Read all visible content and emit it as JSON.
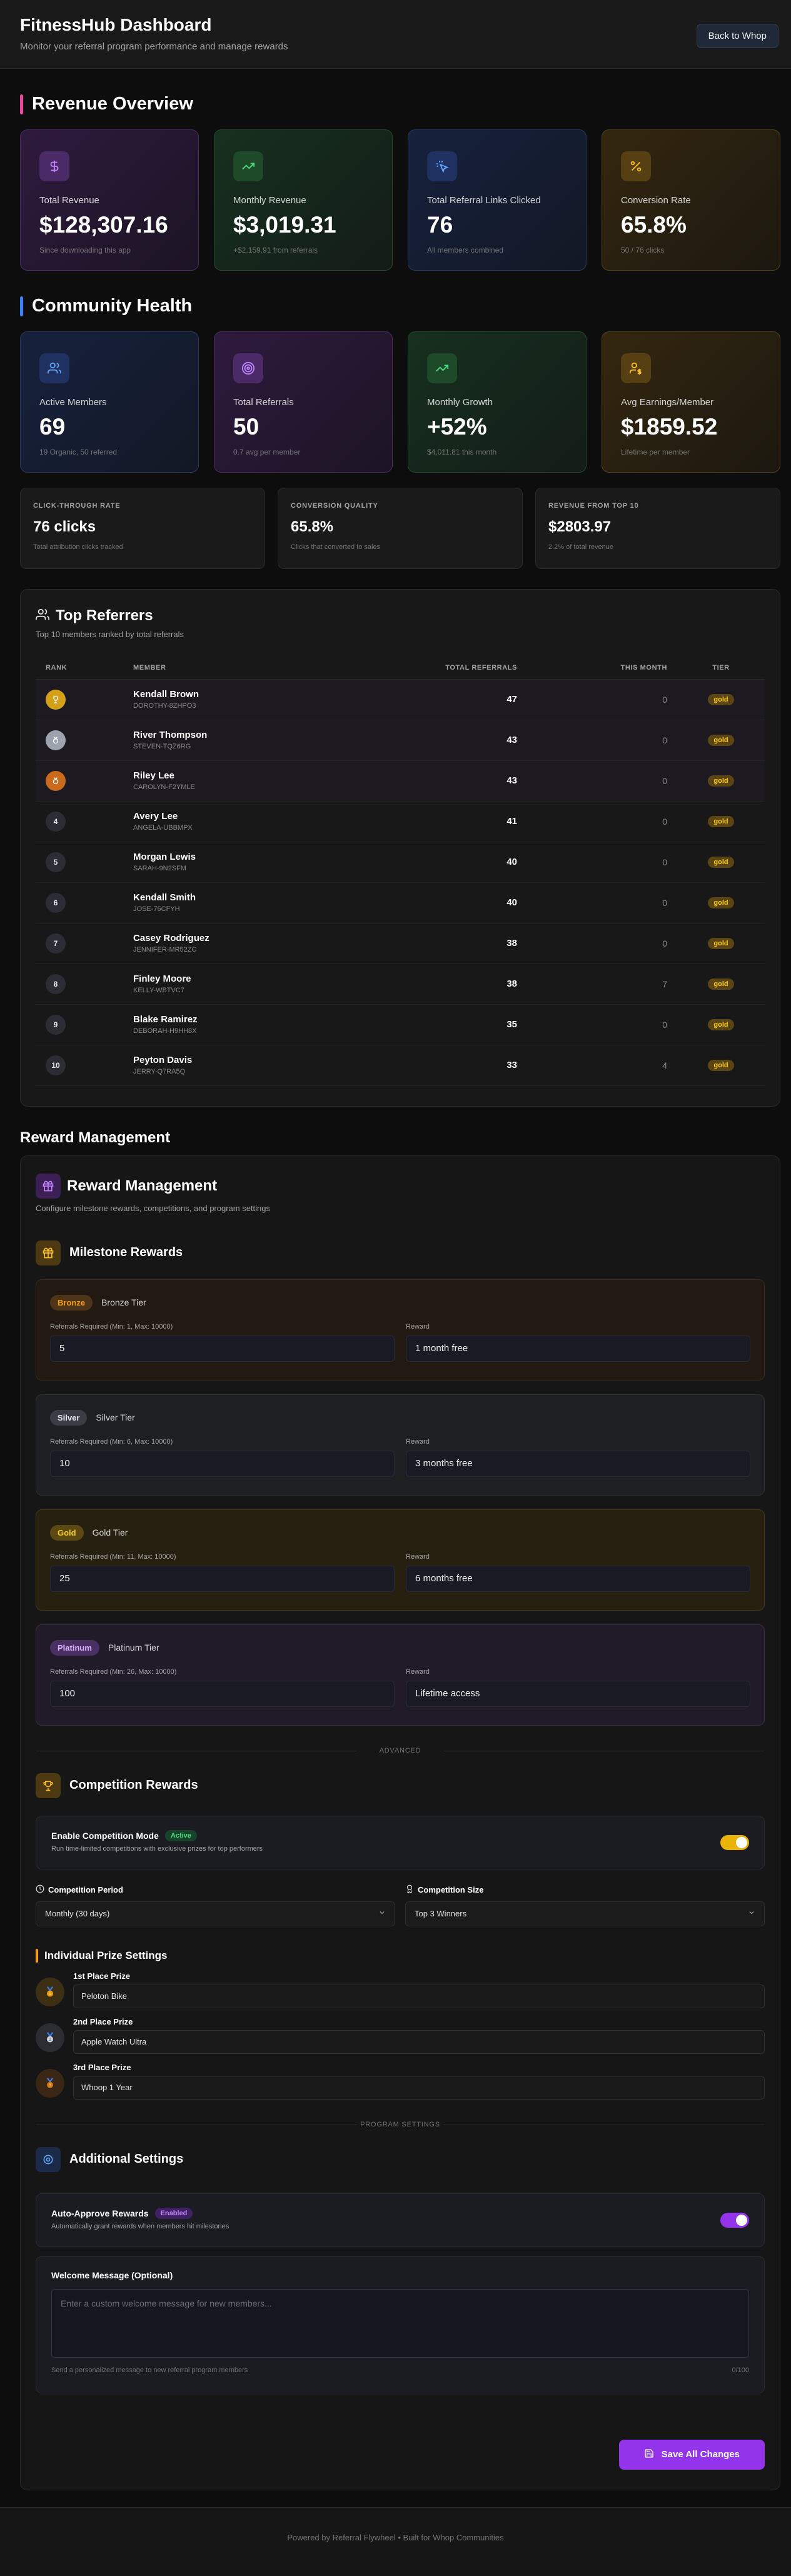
{
  "header": {
    "title": "FitnessHub Dashboard",
    "subtitle": "Monitor your referral program performance and manage rewards",
    "back_label": "Back to Whop"
  },
  "revenue": {
    "title": "Revenue Overview",
    "cards": [
      {
        "label": "Total Revenue",
        "value": "$128,307.16",
        "sub": "Since downloading this app",
        "icon": "dollar-icon"
      },
      {
        "label": "Monthly Revenue",
        "value": "$3,019.31",
        "sub": "+$2,159.91 from referrals",
        "icon": "trending-up-icon"
      },
      {
        "label": "Total Referral Links Clicked",
        "value": "76",
        "sub": "All members combined",
        "icon": "click-icon"
      },
      {
        "label": "Conversion Rate",
        "value": "65.8%",
        "sub": "50 / 76 clicks",
        "icon": "percent-icon"
      }
    ]
  },
  "community": {
    "title": "Community Health",
    "cards": [
      {
        "label": "Active Members",
        "value": "69",
        "sub": "19 Organic, 50 referred",
        "icon": "users-icon"
      },
      {
        "label": "Total Referrals",
        "value": "50",
        "sub": "0.7 avg per member",
        "icon": "target-icon"
      },
      {
        "label": "Monthly Growth",
        "value": "+52%",
        "sub": "$4,011.81 this month",
        "icon": "trending-up-icon"
      },
      {
        "label": "Avg Earnings/Member",
        "value": "$1859.52",
        "sub": "Lifetime per member",
        "icon": "user-dollar-icon"
      }
    ],
    "mini": [
      {
        "label": "CLICK-THROUGH RATE",
        "value": "76 clicks",
        "sub": "Total attribution clicks tracked"
      },
      {
        "label": "CONVERSION QUALITY",
        "value": "65.8%",
        "sub": "Clicks that converted to sales"
      },
      {
        "label": "REVENUE FROM TOP 10",
        "value": "$2803.97",
        "sub": "2.2% of total revenue"
      }
    ]
  },
  "referrers": {
    "title": "Top Referrers",
    "subtitle": "Top 10 members ranked by total referrals",
    "columns": {
      "rank": "RANK",
      "member": "MEMBER",
      "total": "TOTAL REFERRALS",
      "month": "THIS MONTH",
      "tier": "TIER"
    },
    "rows": [
      {
        "rank": "1",
        "name": "Kendall Brown",
        "handle": "DOROTHY-8ZHPO3",
        "total": "47",
        "month": "0",
        "tier": "gold"
      },
      {
        "rank": "2",
        "name": "River Thompson",
        "handle": "STEVEN-TQZ6RG",
        "total": "43",
        "month": "0",
        "tier": "gold"
      },
      {
        "rank": "3",
        "name": "Riley Lee",
        "handle": "CAROLYN-F2YMLE",
        "total": "43",
        "month": "0",
        "tier": "gold"
      },
      {
        "rank": "4",
        "name": "Avery Lee",
        "handle": "ANGELA-UBBMPX",
        "total": "41",
        "month": "0",
        "tier": "gold"
      },
      {
        "rank": "5",
        "name": "Morgan Lewis",
        "handle": "SARAH-9N2SFM",
        "total": "40",
        "month": "0",
        "tier": "gold"
      },
      {
        "rank": "6",
        "name": "Kendall Smith",
        "handle": "JOSE-76CFYH",
        "total": "40",
        "month": "0",
        "tier": "gold"
      },
      {
        "rank": "7",
        "name": "Casey Rodriguez",
        "handle": "JENNIFER-MR52ZC",
        "total": "38",
        "month": "0",
        "tier": "gold"
      },
      {
        "rank": "8",
        "name": "Finley Moore",
        "handle": "KELLY-WBTVC7",
        "total": "38",
        "month": "7",
        "tier": "gold"
      },
      {
        "rank": "9",
        "name": "Blake Ramirez",
        "handle": "DEBORAH-H9HH8X",
        "total": "35",
        "month": "0",
        "tier": "gold"
      },
      {
        "rank": "10",
        "name": "Peyton Davis",
        "handle": "JERRY-Q7RA5Q",
        "total": "33",
        "month": "4",
        "tier": "gold"
      }
    ]
  },
  "reward": {
    "outer_title": "Reward Management",
    "title": "Reward Management",
    "subtitle": "Configure milestone rewards, competitions, and program settings",
    "milestone_title": "Milestone Rewards",
    "tiers": [
      {
        "pill": "Bronze",
        "name": "Bronze Tier",
        "req_label": "Referrals Required (Min: 1, Max: 10000)",
        "req_value": "5",
        "reward_label": "Reward",
        "reward_value": "1 month free",
        "cls": "bronze"
      },
      {
        "pill": "Silver",
        "name": "Silver Tier",
        "req_label": "Referrals Required (Min: 6, Max: 10000)",
        "req_value": "10",
        "reward_label": "Reward",
        "reward_value": "3 months free",
        "cls": "silver"
      },
      {
        "pill": "Gold",
        "name": "Gold Tier",
        "req_label": "Referrals Required (Min: 11, Max: 10000)",
        "req_value": "25",
        "reward_label": "Reward",
        "reward_value": "6 months free",
        "cls": "gold"
      },
      {
        "pill": "Platinum",
        "name": "Platinum Tier",
        "req_label": "Referrals Required (Min: 26, Max: 10000)",
        "req_value": "100",
        "reward_label": "Reward",
        "reward_value": "Lifetime access",
        "cls": "platinum"
      }
    ],
    "advanced_label": "ADVANCED",
    "competition_title": "Competition Rewards",
    "competition_toggle_title": "Enable Competition Mode",
    "competition_badge": "Active",
    "competition_toggle_sub": "Run time-limited competitions with exclusive prizes for top performers",
    "period_label": "Competition Period",
    "period_value": "Monthly (30 days)",
    "size_label": "Competition Size",
    "size_value": "Top 3 Winners",
    "prize_heading": "Individual Prize Settings",
    "prizes": [
      {
        "label": "1st Place Prize",
        "value": "Peloton Bike"
      },
      {
        "label": "2nd Place Prize",
        "value": "Apple Watch Ultra"
      },
      {
        "label": "3rd Place Prize",
        "value": "Whoop 1 Year"
      }
    ],
    "program_label": "PROGRAM SETTINGS",
    "additional_title": "Additional Settings",
    "auto_title": "Auto-Approve Rewards",
    "auto_badge": "Enabled",
    "auto_sub": "Automatically grant rewards when members hit milestones",
    "welcome_label": "Welcome Message (Optional)",
    "welcome_placeholder": "Enter a custom welcome message for new members...",
    "welcome_hint": "Send a personalized message to new referral program members",
    "welcome_count": "0/100",
    "save_label": "Save All Changes"
  },
  "footer": {
    "text": "Powered by Referral Flywheel • Built for Whop Communities"
  },
  "colors": {
    "accent": "#9333ea",
    "revenue_bar": "#ec4899",
    "community_bar": "#3b82f6",
    "toggle_competition": "#eab308"
  }
}
